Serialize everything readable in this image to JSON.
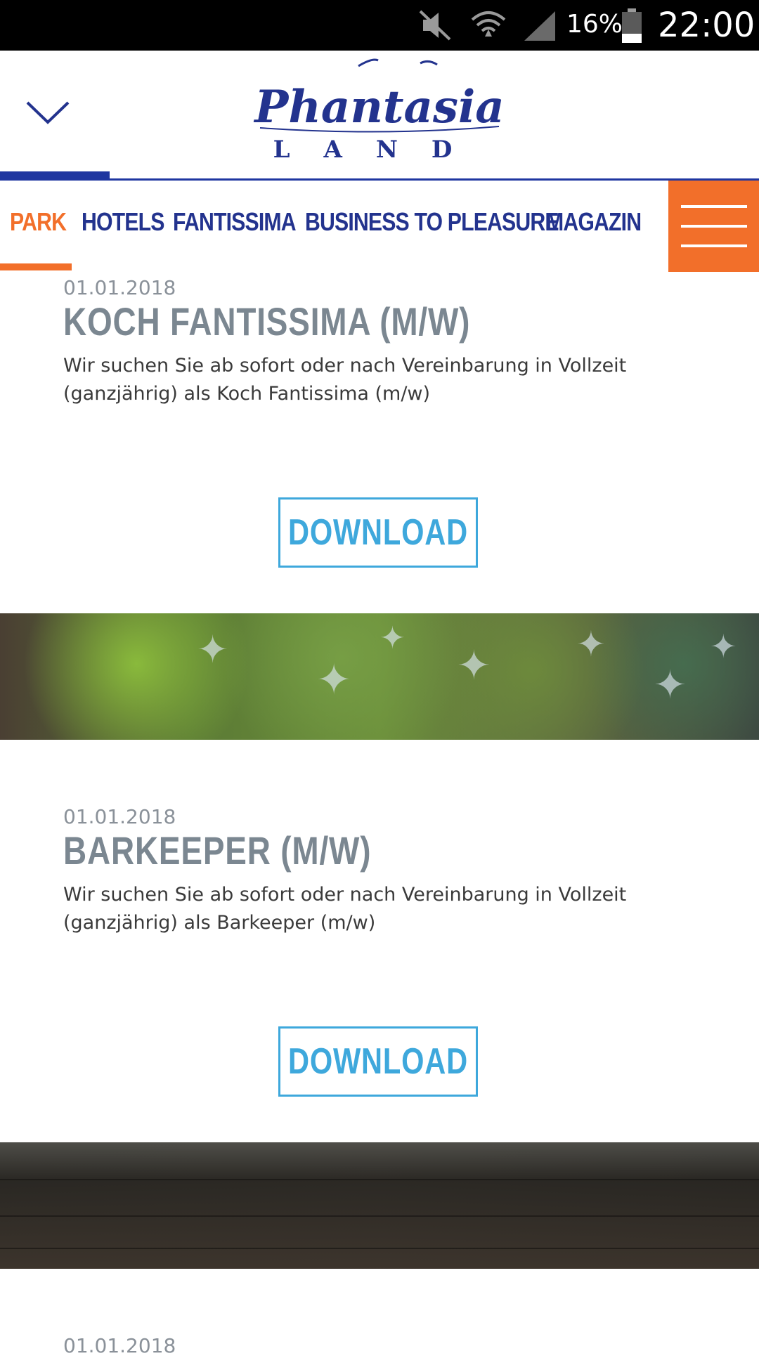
{
  "status_bar": {
    "battery_percent": "16%",
    "time": "22:00",
    "icons": [
      "mute-icon",
      "wifi-icon",
      "signal-icon",
      "battery-icon"
    ]
  },
  "header": {
    "logo": {
      "alt": "Phantasialand logo",
      "line1": "Phantasia",
      "line2": "LAND"
    },
    "toggle_icon": "chevron-down-icon"
  },
  "nav": {
    "items": [
      {
        "label": "PARK",
        "active": true
      },
      {
        "label": "HOTELS",
        "active": false
      },
      {
        "label": "FANTISSIMA",
        "active": false
      },
      {
        "label": "BUSINESS TO PLEASURE",
        "active": false
      },
      {
        "label": "MAGAZIN",
        "active": false
      }
    ],
    "menu_icon": "hamburger-menu-icon"
  },
  "jobs": [
    {
      "date": "01.01.2018",
      "title": "KOCH FANTISSIMA (M/W)",
      "description": "Wir suchen Sie ab sofort oder nach Vereinbarung in Vollzeit (ganzjährig) als Koch Fantissima (m/w)",
      "download_label": "DOWNLOAD"
    },
    {
      "date": "01.01.2018",
      "title": "BARKEEPER (M/W)",
      "description": "Wir suchen Sie ab sofort oder nach Vereinbarung in Vollzeit (ganzjährig) als Barkeeper (m/w)",
      "download_label": "DOWNLOAD"
    },
    {
      "date": "01.01.2018"
    }
  ],
  "colors": {
    "brand_blue": "#23338e",
    "accent_orange": "#f26f2a",
    "download_blue": "#3ea8dc",
    "title_gray": "#7b8791"
  }
}
